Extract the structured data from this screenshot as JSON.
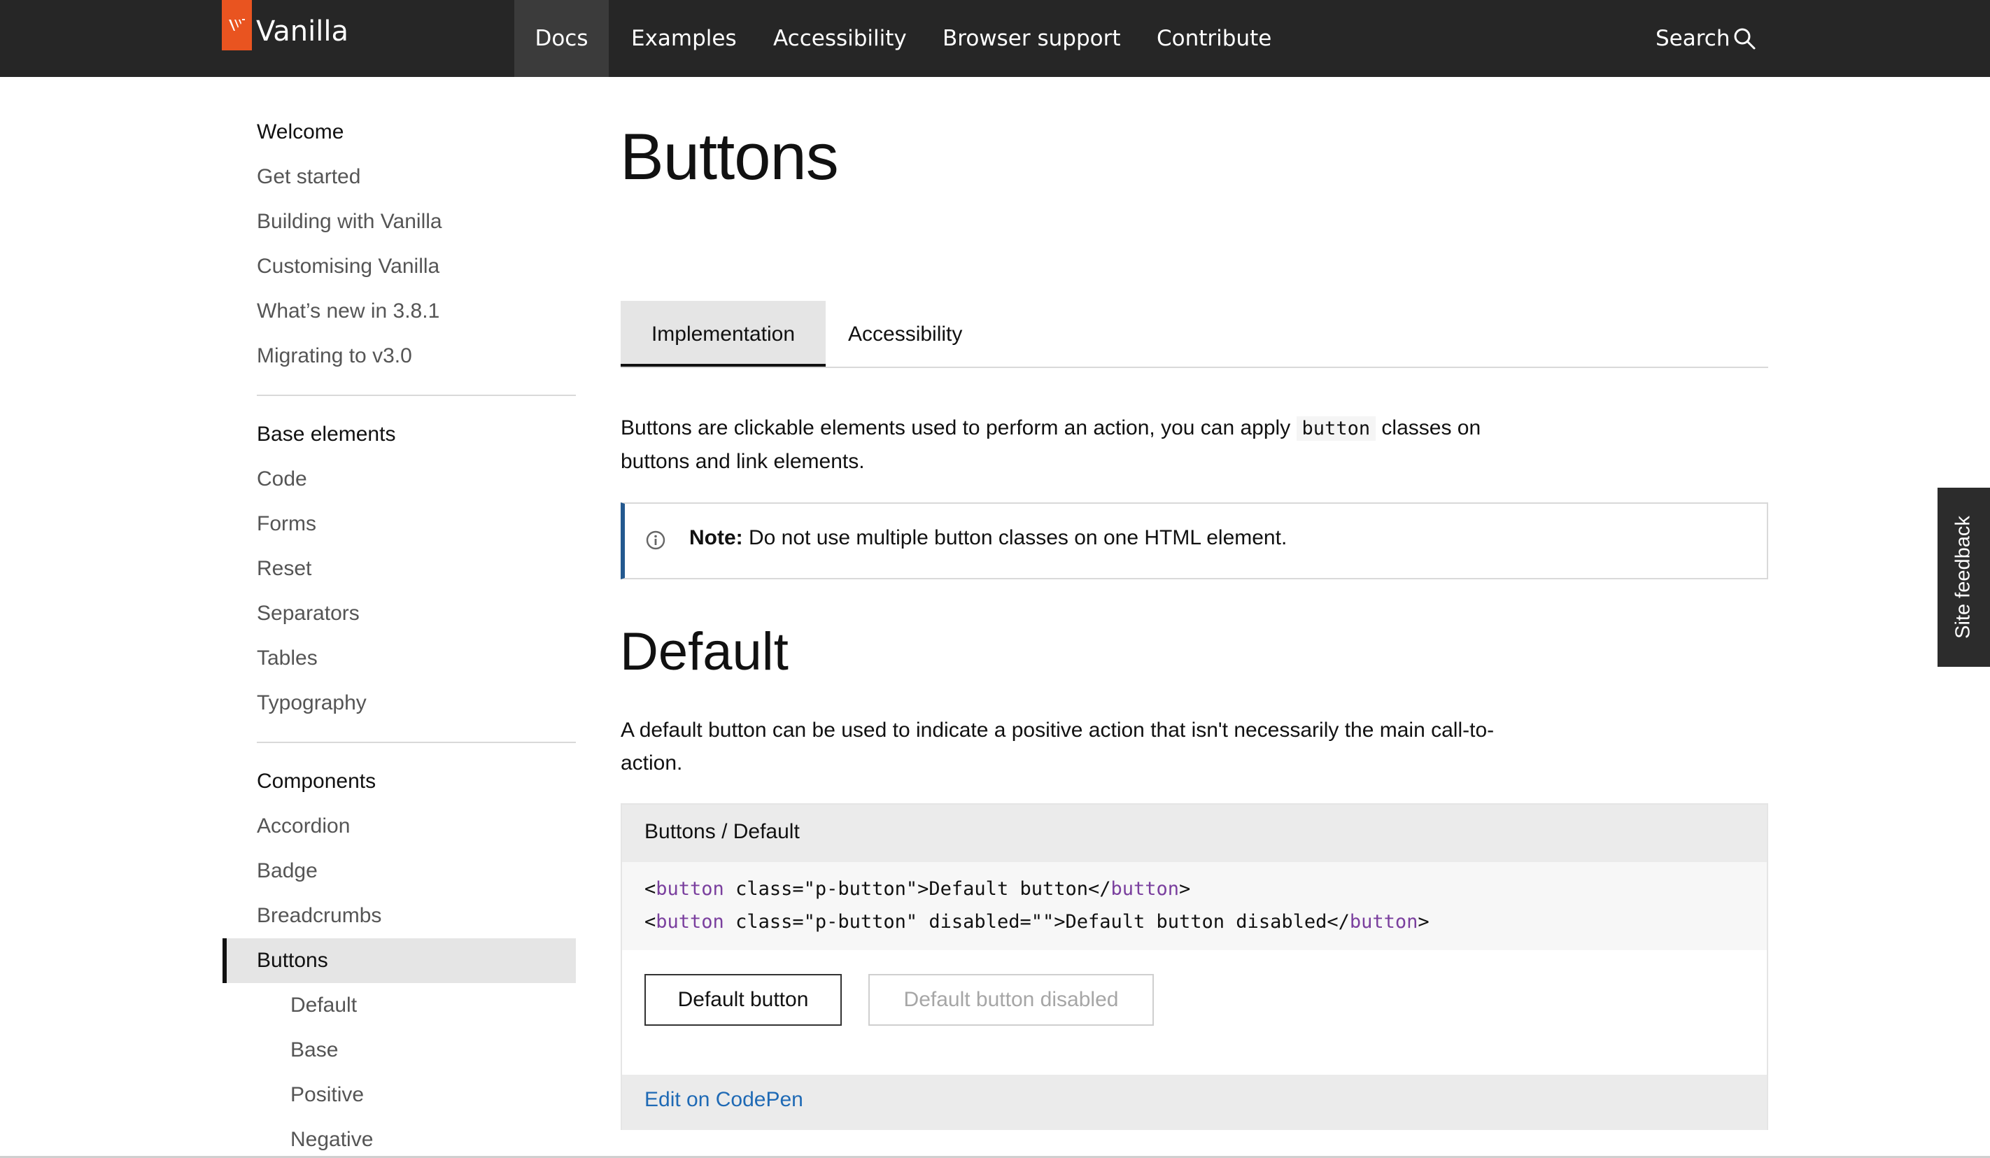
{
  "header": {
    "brand": "Vanilla",
    "nav": [
      "Docs",
      "Examples",
      "Accessibility",
      "Browser support",
      "Contribute"
    ],
    "search_label": "Search",
    "accent_color": "#E95420",
    "active_nav": "Docs"
  },
  "sidebar": {
    "sections": [
      {
        "heading": "Welcome",
        "items": [
          "Get started",
          "Building with Vanilla",
          "Customising Vanilla",
          "What’s new in 3.8.1",
          "Migrating to v3.0"
        ]
      },
      {
        "heading": "Base elements",
        "items": [
          "Code",
          "Forms",
          "Reset",
          "Separators",
          "Tables",
          "Typography"
        ]
      },
      {
        "heading": "Components",
        "items": [
          "Accordion",
          "Badge",
          "Breadcrumbs",
          "Buttons"
        ]
      }
    ],
    "active_item": "Buttons",
    "sub_items": [
      "Default",
      "Base",
      "Positive",
      "Negative"
    ]
  },
  "main": {
    "title": "Buttons",
    "tabs": [
      "Implementation",
      "Accessibility"
    ],
    "active_tab": "Implementation",
    "intro_before": "Buttons are clickable elements used to perform an action, you can apply ",
    "intro_code": "button",
    "intro_after": " classes on buttons and link elements.",
    "note_label": "Note:",
    "note_text": " Do not use multiple button classes on one HTML element.",
    "section_title": "Default",
    "section_text": "A default button can be used to indicate a positive action that isn't necessarily the main call-to-action.",
    "example": {
      "title": "Buttons / Default",
      "code_lines": [
        "<button class=\"p-button\">Default button</button>",
        "<button class=\"p-button\" disabled=\"\">Default button disabled</button>"
      ],
      "buttons": [
        "Default button",
        "Default button disabled"
      ],
      "codepen_link": "Edit on CodePen"
    }
  },
  "feedback": {
    "label": "Site feedback"
  }
}
